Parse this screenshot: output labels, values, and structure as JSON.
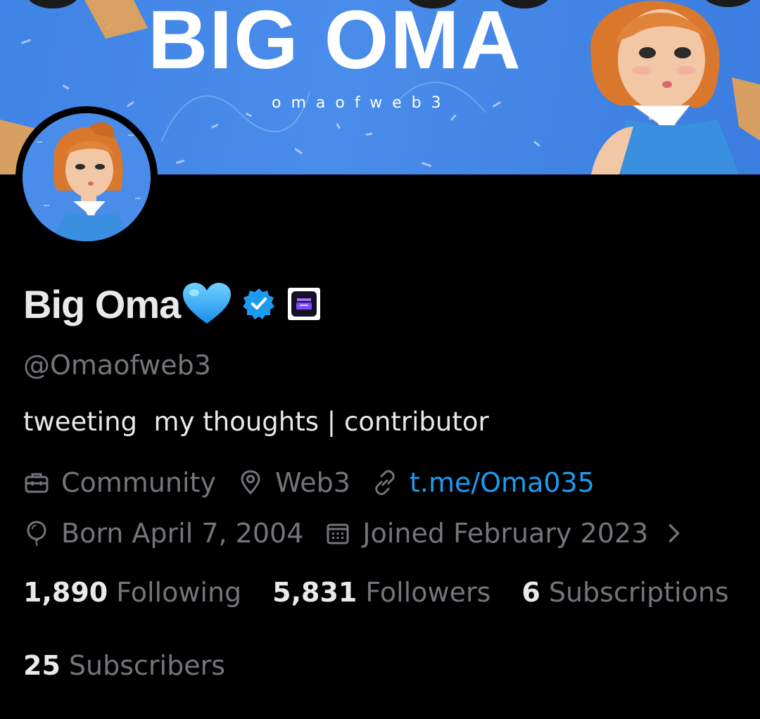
{
  "banner": {
    "title": "BIG OMA",
    "subtitle": "omaofweb3"
  },
  "profile": {
    "display_name": "Big Oma",
    "handle": "@Omaofweb3",
    "bio": "tweeting  my thoughts | contributor",
    "category": "Community",
    "location": "Web3",
    "website": "t.me/Oma035",
    "born": "Born April 7, 2004",
    "joined": "Joined February 2023"
  },
  "stats": {
    "following_count": "1,890",
    "following_label": "Following",
    "followers_count": "5,831",
    "followers_label": "Followers",
    "subscriptions_count": "6",
    "subscriptions_label": "Subscriptions",
    "subscribers_count": "25",
    "subscribers_label": "Subscribers"
  },
  "colors": {
    "accent": "#1d9bf0",
    "secondary_text": "#71767b",
    "primary_text": "#e7e9ea",
    "banner_blue": "#4a8cea"
  },
  "icons": [
    "heart-icon",
    "verified-icon",
    "affiliate-badge-icon",
    "briefcase-icon",
    "location-pin-icon",
    "link-icon",
    "balloon-icon",
    "calendar-icon",
    "chevron-right-icon"
  ]
}
